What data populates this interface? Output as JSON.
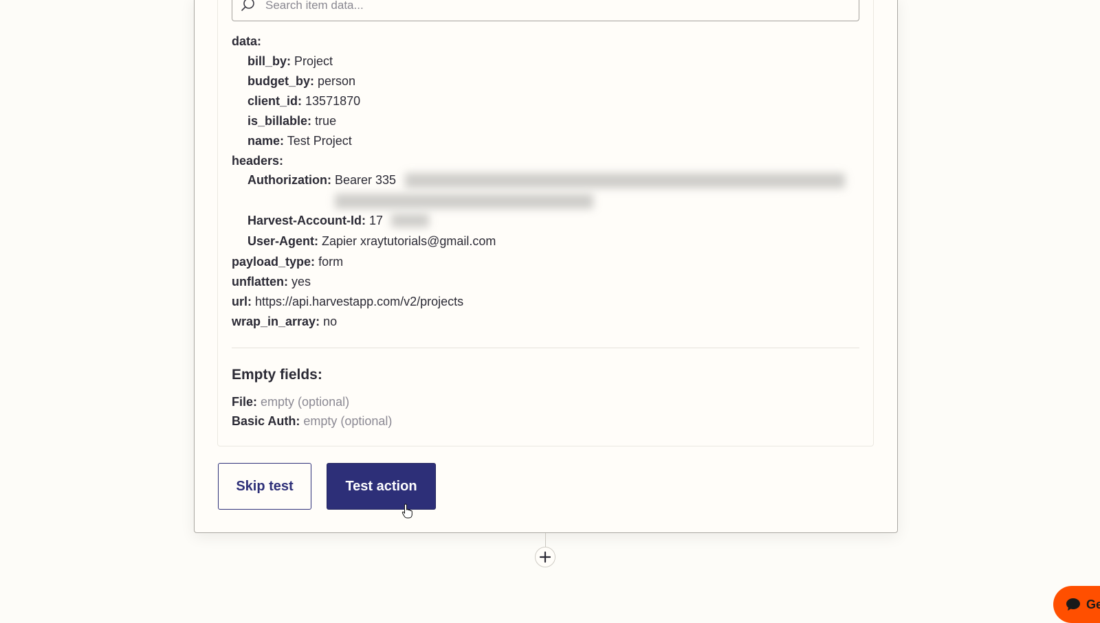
{
  "search": {
    "placeholder": "Search item data..."
  },
  "data_tree": {
    "data_key": "data:",
    "bill_by_key": "bill_by:",
    "bill_by_val": "Project",
    "budget_by_key": "budget_by:",
    "budget_by_val": "person",
    "client_id_key": "client_id:",
    "client_id_val": "13571870",
    "is_billable_key": "is_billable:",
    "is_billable_val": "true",
    "name_key": "name:",
    "name_val": "Test Project",
    "headers_key": "headers:",
    "authorization_key": "Authorization:",
    "authorization_val": "Bearer 335",
    "harvest_account_key": "Harvest-Account-Id:",
    "harvest_account_val": "17",
    "user_agent_key": "User-Agent:",
    "user_agent_val": "Zapier xraytutorials@gmail.com",
    "payload_type_key": "payload_type:",
    "payload_type_val": "form",
    "unflatten_key": "unflatten:",
    "unflatten_val": "yes",
    "url_key": "url:",
    "url_val": "https://api.harvestapp.com/v2/projects",
    "wrap_in_array_key": "wrap_in_array:",
    "wrap_in_array_val": "no"
  },
  "empty_fields": {
    "title": "Empty fields:",
    "file_key": "File:",
    "file_val": "empty (optional)",
    "basic_auth_key": "Basic Auth:",
    "basic_auth_val": "empty (optional)"
  },
  "buttons": {
    "skip": "Skip test",
    "test": "Test action"
  },
  "chat": {
    "label": "Ge"
  },
  "colors": {
    "primary": "#2d2f78",
    "chat": "#ff4f00",
    "background": "#fdfcf8"
  }
}
